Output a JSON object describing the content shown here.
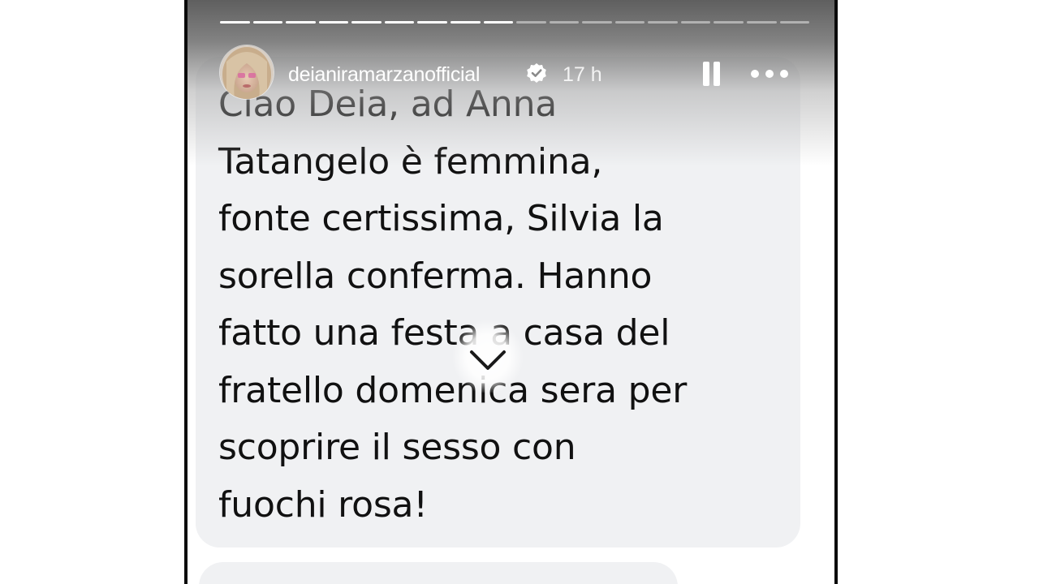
{
  "story": {
    "progress_total": 18,
    "progress_done": 9
  },
  "header": {
    "username": "deianiramarzanofficial",
    "time": "17 h",
    "verified": true,
    "pause_icon": "pause-icon",
    "more_icon": "more-horizontal-icon"
  },
  "message": {
    "text": "Ciao Deia,  ad Anna\nTatangelo è femmina,\nfonte certissima, Silvia la\nsorella conferma. Hanno\nfatto una festa a casa del\nfratello domenica sera per\nscoprire il sesso con\nfuochi rosa!"
  },
  "overlay": {
    "icon": "chevron-down-icon"
  },
  "colors": {
    "bubble": "#f0f1f3",
    "text": "#111111",
    "frame_border": "#0b0b0b",
    "header_text": "#ffffff"
  }
}
